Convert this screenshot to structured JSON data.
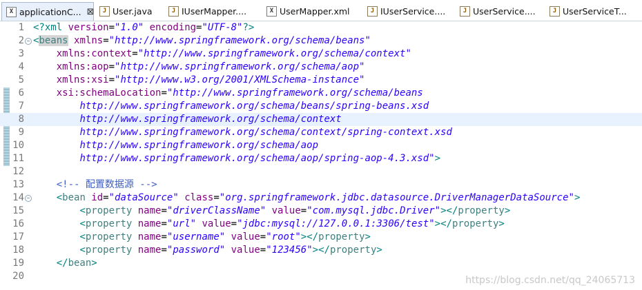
{
  "tabs": [
    {
      "label": "applicationC...",
      "icon": "xml-file-icon",
      "active": true
    },
    {
      "label": "User.java",
      "icon": "java-file-icon"
    },
    {
      "label": "IUserMapper....",
      "icon": "java-file-icon"
    },
    {
      "label": "UserMapper.xml",
      "icon": "xml-file-icon"
    },
    {
      "label": "IUserService....",
      "icon": "java-file-icon"
    },
    {
      "label": "UserService....",
      "icon": "java-file-icon"
    },
    {
      "label": "UserServiceT...",
      "icon": "java-file-icon"
    }
  ],
  "editor": {
    "lines": [
      {
        "n": "1",
        "fold": "",
        "tokens": [
          [
            "br",
            "<?"
          ],
          [
            "pi",
            "xml "
          ],
          [
            "at",
            "version"
          ],
          [
            "",
            "="
          ],
          [
            "av",
            "\"1.0\""
          ],
          [
            "at",
            " encoding"
          ],
          [
            "",
            "="
          ],
          [
            "av",
            "\"UTF-8\""
          ],
          [
            "br",
            "?>"
          ]
        ]
      },
      {
        "n": "2",
        "fold": "−",
        "tokens": [
          [
            "br",
            "<"
          ],
          [
            "tgh",
            "beans"
          ],
          [
            "",
            " "
          ],
          [
            "at",
            "xmlns"
          ],
          [
            "",
            "="
          ],
          [
            "av",
            "\"http://www.springframework.org/schema/beans\""
          ]
        ]
      },
      {
        "n": "3",
        "fold": "",
        "tokens": [
          [
            "",
            "    "
          ],
          [
            "at",
            "xmlns:context"
          ],
          [
            "",
            "="
          ],
          [
            "av",
            "\"http://www.springframework.org/schema/context\""
          ]
        ]
      },
      {
        "n": "4",
        "fold": "",
        "tokens": [
          [
            "",
            "    "
          ],
          [
            "at",
            "xmlns:aop"
          ],
          [
            "",
            "="
          ],
          [
            "av",
            "\"http://www.springframework.org/schema/aop\""
          ]
        ]
      },
      {
        "n": "5",
        "fold": "",
        "tokens": [
          [
            "",
            "    "
          ],
          [
            "at",
            "xmlns:xsi"
          ],
          [
            "",
            "="
          ],
          [
            "av",
            "\"http://www.w3.org/2001/XMLSchema-instance\""
          ]
        ]
      },
      {
        "n": "6",
        "fold": "",
        "tokens": [
          [
            "",
            "    "
          ],
          [
            "at",
            "xsi:schemaLocation"
          ],
          [
            "",
            "="
          ],
          [
            "av",
            "\"http://www.springframework.org/schema/beans"
          ]
        ]
      },
      {
        "n": "7",
        "fold": "",
        "tokens": [
          [
            "",
            "        "
          ],
          [
            "av",
            "http://www.springframework.org/schema/beans/spring-beans.xsd"
          ]
        ]
      },
      {
        "n": "8",
        "fold": "",
        "cur": true,
        "tokens": [
          [
            "",
            "        "
          ],
          [
            "av",
            "http://www.springframework.org/schema/context"
          ]
        ]
      },
      {
        "n": "9",
        "fold": "",
        "tokens": [
          [
            "",
            "        "
          ],
          [
            "av",
            "http://www.springframework.org/schema/context/spring-context.xsd"
          ]
        ]
      },
      {
        "n": "10",
        "fold": "",
        "tokens": [
          [
            "",
            "        "
          ],
          [
            "av",
            "http://www.springframework.org/schema/aop"
          ]
        ]
      },
      {
        "n": "11",
        "fold": "",
        "tokens": [
          [
            "",
            "        "
          ],
          [
            "av",
            "http://www.springframework.org/schema/aop/spring-aop-4.3.xsd\""
          ],
          [
            "br",
            ">"
          ]
        ]
      },
      {
        "n": "12",
        "fold": "",
        "tokens": []
      },
      {
        "n": "13",
        "fold": "",
        "tokens": [
          [
            "",
            "    "
          ],
          [
            "cm",
            "<!-- 配置数据源 -->"
          ]
        ]
      },
      {
        "n": "14",
        "fold": "−",
        "tokens": [
          [
            "",
            "    "
          ],
          [
            "br",
            "<"
          ],
          [
            "tg",
            "bean"
          ],
          [
            "at",
            " id"
          ],
          [
            "",
            "="
          ],
          [
            "av",
            "\"dataSource\""
          ],
          [
            "at",
            " class"
          ],
          [
            "",
            "="
          ],
          [
            "av",
            "\"org.springframework.jdbc.datasource.DriverManagerDataSource\""
          ],
          [
            "br",
            ">"
          ]
        ]
      },
      {
        "n": "15",
        "fold": "",
        "tokens": [
          [
            "",
            "        "
          ],
          [
            "br",
            "<"
          ],
          [
            "tg",
            "property"
          ],
          [
            "at",
            " name"
          ],
          [
            "",
            "="
          ],
          [
            "av",
            "\"driverClassName\""
          ],
          [
            "at",
            " value"
          ],
          [
            "",
            "="
          ],
          [
            "av",
            "\"com.mysql.jdbc.Driver\""
          ],
          [
            "br",
            "></"
          ],
          [
            "tg",
            "property"
          ],
          [
            "br",
            ">"
          ]
        ]
      },
      {
        "n": "16",
        "fold": "",
        "tokens": [
          [
            "",
            "        "
          ],
          [
            "br",
            "<"
          ],
          [
            "tg",
            "property"
          ],
          [
            "at",
            " name"
          ],
          [
            "",
            "="
          ],
          [
            "av",
            "\"url\""
          ],
          [
            "at",
            " value"
          ],
          [
            "",
            "="
          ],
          [
            "av",
            "\"jdbc:mysql://127.0.0.1:3306/test\""
          ],
          [
            "br",
            "></"
          ],
          [
            "tg",
            "property"
          ],
          [
            "br",
            ">"
          ]
        ]
      },
      {
        "n": "17",
        "fold": "",
        "tokens": [
          [
            "",
            "        "
          ],
          [
            "br",
            "<"
          ],
          [
            "tg",
            "property"
          ],
          [
            "at",
            " name"
          ],
          [
            "",
            "="
          ],
          [
            "av",
            "\"username\""
          ],
          [
            "at",
            " value"
          ],
          [
            "",
            "="
          ],
          [
            "av",
            "\"root\""
          ],
          [
            "br",
            "></"
          ],
          [
            "tg",
            "property"
          ],
          [
            "br",
            ">"
          ]
        ]
      },
      {
        "n": "18",
        "fold": "",
        "tokens": [
          [
            "",
            "        "
          ],
          [
            "br",
            "<"
          ],
          [
            "tg",
            "property"
          ],
          [
            "at",
            " name"
          ],
          [
            "",
            "="
          ],
          [
            "av",
            "\"password\""
          ],
          [
            "at",
            " value"
          ],
          [
            "",
            "="
          ],
          [
            "av",
            "\"123456\""
          ],
          [
            "br",
            "></"
          ],
          [
            "tg",
            "property"
          ],
          [
            "br",
            ">"
          ]
        ]
      },
      {
        "n": "19",
        "fold": "",
        "tokens": [
          [
            "",
            "    "
          ],
          [
            "br",
            "</"
          ],
          [
            "tg",
            "bean"
          ],
          [
            "br",
            ">"
          ]
        ]
      },
      {
        "n": "20",
        "fold": "",
        "tokens": []
      }
    ]
  },
  "watermark": "https://blog.csdn.net/qq_24065713"
}
